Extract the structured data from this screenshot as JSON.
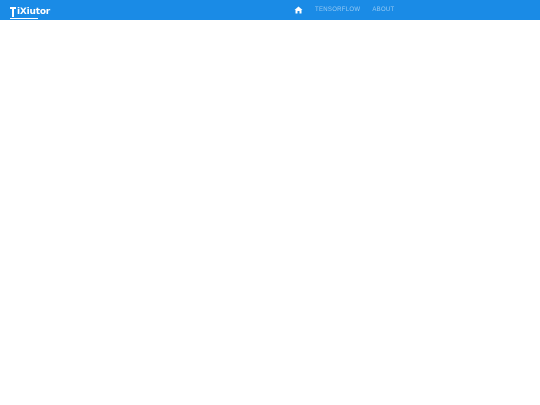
{
  "brand": {
    "logo_text": "iXiutor"
  },
  "navbar": {
    "background_color": "#1a8be6",
    "home_icon": "home-icon",
    "items": [
      {
        "label": "TENSORFLOW"
      },
      {
        "label": "ABOUT"
      }
    ]
  }
}
